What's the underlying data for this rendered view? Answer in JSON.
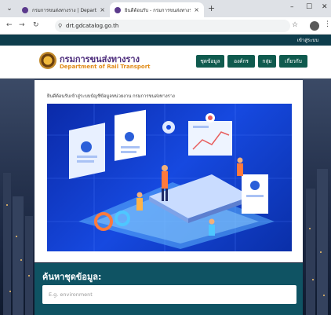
{
  "browser": {
    "tabs": [
      {
        "title": "กรมการขนส่งทางราง | Departmen"
      },
      {
        "title": "ยินดีต้อนรับ - กรมการขนส่งทางราง"
      }
    ],
    "url": "drt.gdcatalog.go.th"
  },
  "topbar": {
    "login_label": "เข้าสู่ระบบ"
  },
  "header": {
    "brand_th": "กรมการขนส่งทางราง",
    "brand_en": "Department of Rail Transport",
    "nav": [
      {
        "label": "ชุดข้อมูล"
      },
      {
        "label": "องค์กร"
      },
      {
        "label": "กลุ่ม"
      },
      {
        "label": "เกี่ยวกับ"
      }
    ]
  },
  "main": {
    "welcome_text": "ยินดีต้อนรับเข้าสู่ระบบบัญชีข้อมูลหน่วยงาน กรมการขนส่งทางราง"
  },
  "search": {
    "title": "ค้นหาชุดข้อมูล:",
    "placeholder": "E.g. environment"
  },
  "colors": {
    "topbar": "#0e3d4c",
    "nav_button": "#0f5a4e",
    "search_panel": "#0f5363",
    "brand_purple": "#4b2a7a",
    "brand_orange": "#e08a16"
  }
}
